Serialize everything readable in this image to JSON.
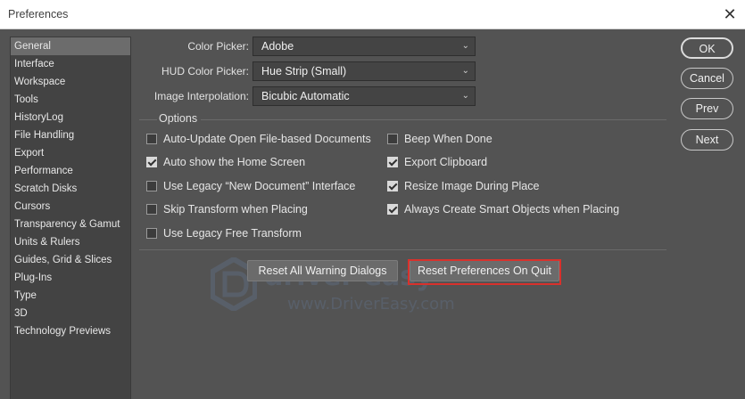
{
  "window": {
    "title": "Preferences",
    "close_glyph": "✕"
  },
  "sidebar": {
    "items": [
      {
        "label": "General"
      },
      {
        "label": "Interface"
      },
      {
        "label": "Workspace"
      },
      {
        "label": "Tools"
      },
      {
        "label": "HistoryLog"
      },
      {
        "label": "File Handling"
      },
      {
        "label": "Export"
      },
      {
        "label": "Performance"
      },
      {
        "label": "Scratch Disks"
      },
      {
        "label": "Cursors"
      },
      {
        "label": "Transparency & Gamut"
      },
      {
        "label": "Units & Rulers"
      },
      {
        "label": "Guides, Grid & Slices"
      },
      {
        "label": "Plug-Ins"
      },
      {
        "label": "Type"
      },
      {
        "label": "3D"
      },
      {
        "label": "Technology Previews"
      }
    ],
    "selected": "General"
  },
  "fields": {
    "color_picker": {
      "label": "Color Picker:",
      "value": "Adobe"
    },
    "hud_color_picker": {
      "label": "HUD Color Picker:",
      "value": "Hue Strip (Small)"
    },
    "image_interpolation": {
      "label": "Image Interpolation:",
      "value": "Bicubic Automatic"
    }
  },
  "options": {
    "title": "Options",
    "left": [
      {
        "label": "Auto-Update Open File-based Documents",
        "checked": false
      },
      {
        "label": "Auto show the Home Screen",
        "checked": true
      },
      {
        "label": "Use Legacy “New Document” Interface",
        "checked": false
      },
      {
        "label": "Skip Transform when Placing",
        "checked": false
      },
      {
        "label": "Use Legacy Free Transform",
        "checked": false
      }
    ],
    "right": [
      {
        "label": "Beep When Done",
        "checked": false
      },
      {
        "label": "Export Clipboard",
        "checked": true
      },
      {
        "label": "Resize Image During Place",
        "checked": true
      },
      {
        "label": "Always Create Smart Objects when Placing",
        "checked": true
      }
    ]
  },
  "buttons": {
    "reset_warnings": "Reset All Warning Dialogs",
    "reset_prefs": "Reset Preferences On Quit",
    "ok": "OK",
    "cancel": "Cancel",
    "prev": "Prev",
    "next": "Next"
  },
  "watermark": {
    "name": "driver easy",
    "url": "www.DriverEasy.com"
  },
  "colors": {
    "highlight": "#d9312c",
    "background": "#535353",
    "selected": "#6c6c6c"
  }
}
